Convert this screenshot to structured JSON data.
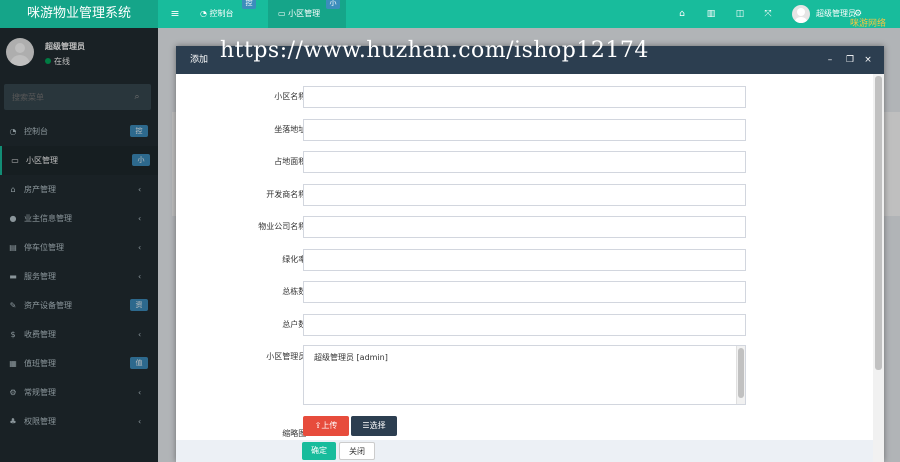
{
  "app": {
    "title": "咪游物业管理系统",
    "brand_watermark": "咪游网络",
    "url_watermark": "https://www.huzhan.com/ishop12174"
  },
  "topbar": {
    "tabs": [
      {
        "icon": "dashboard-icon",
        "label": "控制台",
        "badge": "控"
      },
      {
        "icon": "community-icon",
        "label": "小区管理",
        "badge": "小"
      }
    ],
    "user_name": "超级管理员"
  },
  "sidebar": {
    "profile": {
      "name": "超级管理员",
      "status": "在线"
    },
    "search_placeholder": "搜索菜单",
    "items": [
      {
        "label": "控制台",
        "icon": "dashboard-icon",
        "badge": "控",
        "chevron": ""
      },
      {
        "label": "小区管理",
        "icon": "community-icon",
        "badge": "小",
        "chevron": "",
        "active": true
      },
      {
        "label": "房产管理",
        "icon": "house-icon",
        "badge": "",
        "chevron": "‹"
      },
      {
        "label": "业主信息管理",
        "icon": "user-icon",
        "badge": "",
        "chevron": "‹"
      },
      {
        "label": "停车位管理",
        "icon": "parking-icon",
        "badge": "",
        "chevron": "‹"
      },
      {
        "label": "服务管理",
        "icon": "service-icon",
        "badge": "",
        "chevron": "‹"
      },
      {
        "label": "资产设备管理",
        "icon": "wrench-icon",
        "badge": "资",
        "chevron": ""
      },
      {
        "label": "收费管理",
        "icon": "dollar-icon",
        "badge": "",
        "chevron": "‹"
      },
      {
        "label": "值班管理",
        "icon": "calendar-icon",
        "badge": "值",
        "chevron": ""
      },
      {
        "label": "常规管理",
        "icon": "cogs-icon",
        "badge": "",
        "chevron": "‹"
      },
      {
        "label": "权限管理",
        "icon": "group-icon",
        "badge": "",
        "chevron": "‹"
      }
    ]
  },
  "modal": {
    "title": "添加",
    "fields": [
      {
        "label": "小区名称:",
        "value": ""
      },
      {
        "label": "坐落地址:",
        "value": ""
      },
      {
        "label": "占地面积:",
        "value": ""
      },
      {
        "label": "开发商名称:",
        "value": ""
      },
      {
        "label": "物业公司名称:",
        "value": ""
      },
      {
        "label": "绿化率:",
        "value": ""
      },
      {
        "label": "总栋数:",
        "value": ""
      },
      {
        "label": "总户数:",
        "value": ""
      }
    ],
    "manager_label": "小区管理员:",
    "manager_value": "超级管理员 [admin]",
    "thumbnail_label": "缩略图:",
    "upload_label": "上传",
    "choose_label": "选择",
    "ok_label": "确定",
    "close_label": "关闭"
  },
  "colors": {
    "accent": "#18bc9c",
    "sidebar_bg": "#222d32",
    "modal_header": "#2c3e50",
    "badge": "#3c8dbc",
    "upload": "#e74c3c"
  }
}
